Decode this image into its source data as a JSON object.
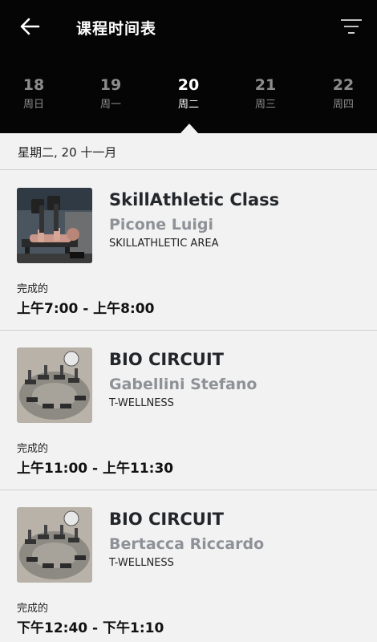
{
  "header": {
    "title": "课程时间表",
    "back_icon": "arrow-left-icon",
    "filter_icon": "filter-lines-icon"
  },
  "days": [
    {
      "num": "18",
      "weekday": "周日",
      "selected": false
    },
    {
      "num": "19",
      "weekday": "周一",
      "selected": false
    },
    {
      "num": "20",
      "weekday": "周二",
      "selected": true
    },
    {
      "num": "21",
      "weekday": "周三",
      "selected": false
    },
    {
      "num": "22",
      "weekday": "周四",
      "selected": false
    }
  ],
  "date_heading": "星期二, 20 十一月",
  "classes": [
    {
      "name": "SkillAthletic Class",
      "trainer": "Picone Luigi",
      "area": "SKILLATHLETIC AREA",
      "status": "完成的",
      "time": "上午7:00 - 上午8:00"
    },
    {
      "name": "BIO CIRCUIT",
      "trainer": "Gabellini Stefano",
      "area": "T-WELLNESS",
      "status": "完成的",
      "time": "上午11:00 - 上午11:30"
    },
    {
      "name": "BIO CIRCUIT",
      "trainer": "Bertacca Riccardo",
      "area": "T-WELLNESS",
      "status": "完成的",
      "time": "下午12:40 - 下午1:10"
    }
  ],
  "colors": {
    "header_bg": "#050505",
    "page_bg": "#f2f2f2",
    "trainer_gray": "#8e9297"
  }
}
